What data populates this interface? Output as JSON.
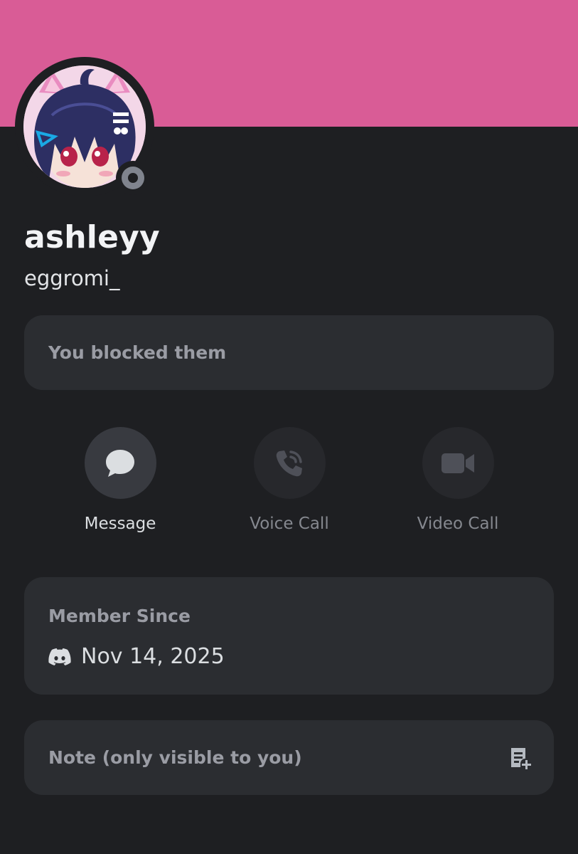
{
  "profile": {
    "display_name": "ashleyy",
    "username": "eggromi_",
    "banner_color": "#d95c96",
    "status": "offline",
    "status_color": "#80848e"
  },
  "blocked_notice": {
    "text": "You blocked them"
  },
  "actions": {
    "message": {
      "label": "Message",
      "icon": "chat-bubble-icon",
      "enabled": true
    },
    "voice_call": {
      "label": "Voice Call",
      "icon": "phone-icon",
      "enabled": false
    },
    "video_call": {
      "label": "Video Call",
      "icon": "camera-icon",
      "enabled": false
    }
  },
  "member_since": {
    "title": "Member Since",
    "icon": "discord-logo-icon",
    "date": "Nov 14, 2025"
  },
  "note": {
    "placeholder": "Note (only visible to you)",
    "icon": "add-note-icon"
  }
}
